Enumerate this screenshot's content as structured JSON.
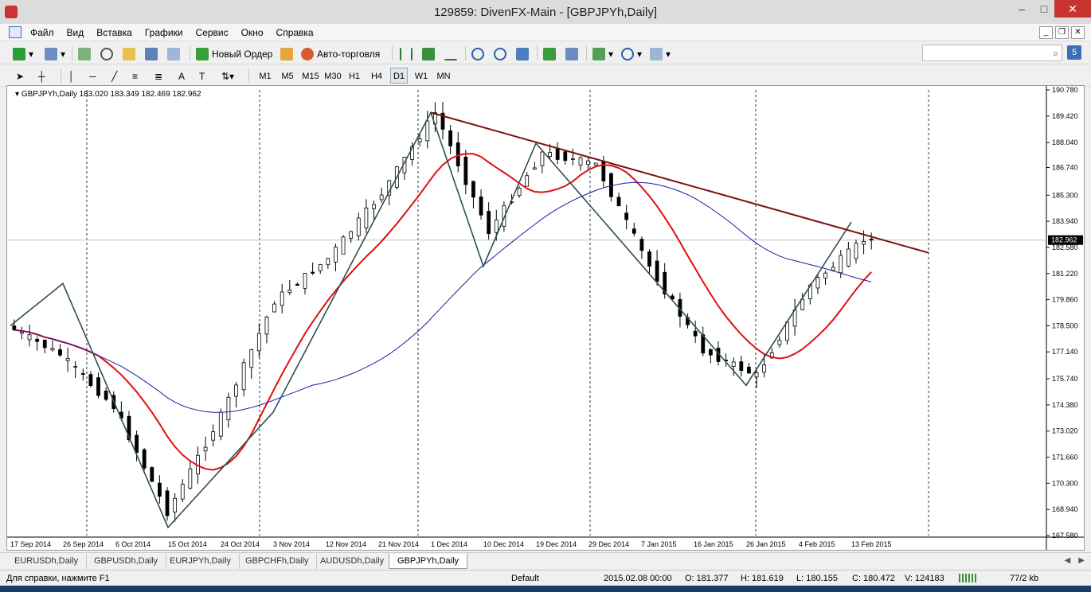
{
  "window": {
    "title": "129859: DivenFX-Main - [GBPJPYh,Daily]",
    "min": "‒",
    "max": "□",
    "close": "✕"
  },
  "menu": [
    "Файл",
    "Вид",
    "Вставка",
    "Графики",
    "Сервис",
    "Окно",
    "Справка"
  ],
  "toolbar": {
    "new_order": "Новый Ордер",
    "auto_trading": "Авто-торговля",
    "notification_count": "5"
  },
  "timeframes": [
    "M1",
    "M5",
    "M15",
    "M30",
    "H1",
    "H4",
    "D1",
    "W1",
    "MN"
  ],
  "active_timeframe": "D1",
  "chart": {
    "symbol_label": "GBPJPYh,Daily",
    "ohlc_label": "183.020 183.349 182.469 182.962",
    "current_price_label": "182.962",
    "y_ticks": [
      "190.780",
      "189.420",
      "188.040",
      "186.740",
      "185.300",
      "183.940",
      "182.580",
      "181.220",
      "179.860",
      "178.500",
      "177.140",
      "175.740",
      "174.380",
      "173.020",
      "171.660",
      "170.300",
      "168.940",
      "167.580"
    ],
    "x_ticks": [
      "17 Sep 2014",
      "26 Sep 2014",
      "6 Oct 2014",
      "15 Oct 2014",
      "24 Oct 2014",
      "3 Nov 2014",
      "12 Nov 2014",
      "21 Nov 2014",
      "1 Dec 2014",
      "10 Dec 2014",
      "19 Dec 2014",
      "29 Dec 2014",
      "7 Jan 2015",
      "16 Jan 2015",
      "26 Jan 2015",
      "4 Feb 2015",
      "13 Feb 2015"
    ],
    "colors": {
      "up": "#ffffff",
      "down": "#000000",
      "ma_fast": "#e01010",
      "ma_slow": "#1c1ca6",
      "zigzag": "#2f4f4f",
      "trendline": "#7a1010",
      "grid": "#000000",
      "price_line": "#c0c0c0"
    }
  },
  "tabs": [
    "EURUSDh,Daily",
    "GBPUSDh,Daily",
    "EURJPYh,Daily",
    "GBPCHFh,Daily",
    "AUDUSDh,Daily",
    "GBPJPYh,Daily"
  ],
  "active_tab": "GBPJPYh,Daily",
  "status": {
    "help": "Для справки, нажмите F1",
    "profile": "Default",
    "datetime": "2015.02.08 00:00",
    "open": "O: 181.377",
    "high": "H: 181.619",
    "low": "L: 180.155",
    "close": "C: 180.472",
    "volume": "V: 124183",
    "traffic": "77/2 kb"
  },
  "chart_data": {
    "type": "candlestick",
    "title": "GBPJPYh,Daily",
    "x": [
      "17 Sep 2014",
      "26 Sep 2014",
      "6 Oct 2014",
      "15 Oct 2014",
      "24 Oct 2014",
      "3 Nov 2014",
      "12 Nov 2014",
      "21 Nov 2014",
      "1 Dec 2014",
      "10 Dec 2014",
      "19 Dec 2014",
      "29 Dec 2014",
      "7 Jan 2015",
      "16 Jan 2015",
      "26 Jan 2015",
      "4 Feb 2015",
      "13 Feb 2015"
    ],
    "ylim": [
      167.58,
      190.78
    ],
    "series": [
      {
        "name": "close",
        "values": [
          178.5,
          177.0,
          174.3,
          168.8,
          173.8,
          179.8,
          182.0,
          185.4,
          189.6,
          183.4,
          187.5,
          186.9,
          181.6,
          177.2,
          175.9,
          180.6,
          182.962
        ]
      }
    ],
    "trendline": {
      "from": [
        189.6,
        "1 Dec 2014"
      ],
      "to": [
        182.3,
        "after 13 Feb 2015"
      ]
    },
    "grid": true
  }
}
